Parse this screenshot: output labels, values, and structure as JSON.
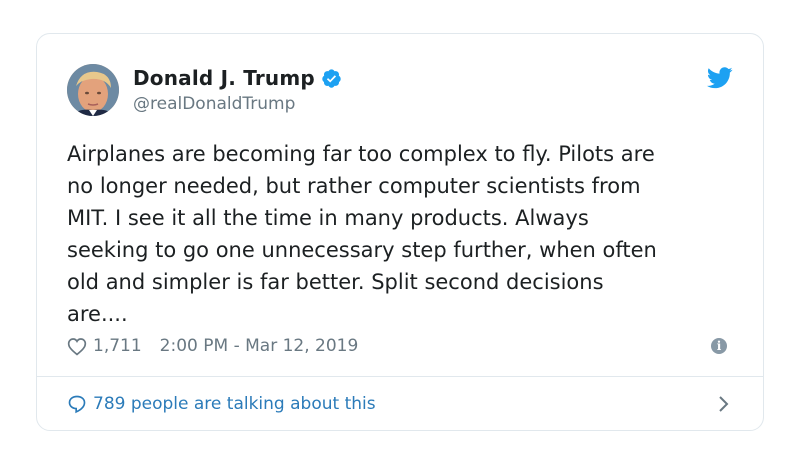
{
  "author": {
    "name": "Donald J. Trump",
    "handle": "@realDonaldTrump",
    "verified": true,
    "avatar_icon": "avatar"
  },
  "tweet": {
    "text": "Airplanes are becoming far too complex to fly. Pilots are\nno longer needed, but rather computer scientists from\nMIT. I see it all the time in many products. Always\nseeking to go one unnecessary step further, when often\nold and simpler is far better. Split second decisions\nare....",
    "likes": "1,711",
    "timestamp": "2:00 PM - Mar 12, 2019"
  },
  "footer": {
    "talking": "789 people are talking about this"
  },
  "colors": {
    "verified_blue": "#1da1f2",
    "twitter_blue": "#1da1f2",
    "link_blue": "#2b7bb9",
    "meta_gray": "#697882"
  }
}
